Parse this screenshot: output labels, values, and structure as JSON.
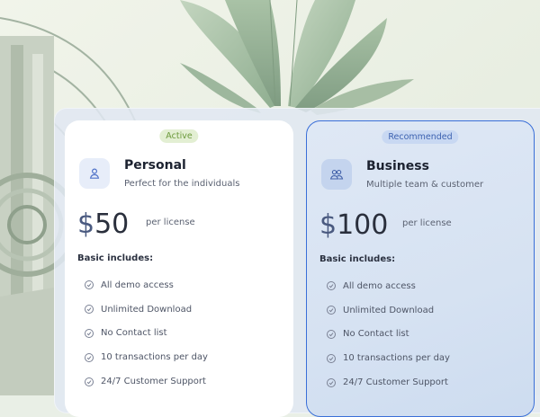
{
  "plans": [
    {
      "badge": "Active",
      "name": "Personal",
      "subtitle": "Perfect for the individuals",
      "currency": "$",
      "amount": "50",
      "per": "per license",
      "includes_title": "Basic includes:",
      "icon": "user-icon",
      "features": [
        "All demo access",
        "Unlimited Download",
        "No Contact list",
        "10 transactions per day",
        "24/7 Customer Support"
      ]
    },
    {
      "badge": "Recommended",
      "name": "Business",
      "subtitle": "Multiple team & customer",
      "currency": "$",
      "amount": "100",
      "per": "per license",
      "includes_title": "Basic includes:",
      "icon": "users-icon",
      "features": [
        "All demo access",
        "Unlimited Download",
        "No Contact list",
        "10 transactions per day",
        "24/7 Customer Support"
      ]
    }
  ],
  "colors": {
    "active_badge": "#6c9a3c",
    "recommended_badge": "#3d62b0",
    "business_border": "#3a6fd8"
  }
}
